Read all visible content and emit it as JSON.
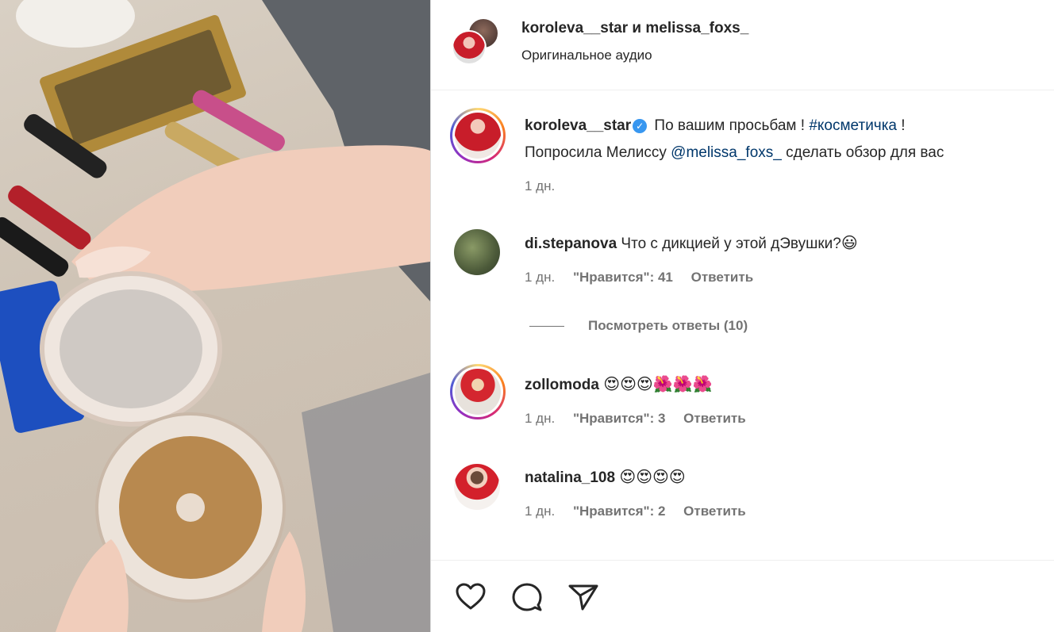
{
  "post": {
    "header_title": "koroleva__star и melissa_foxs_",
    "header_subtitle": "Оригинальное аудио"
  },
  "caption": {
    "username": "koroleva__star",
    "text_1": " По вашим просьбам ! ",
    "hashtag": "#косметичка",
    "text_2": " !",
    "line2_prefix": "Попросила Мелиссу ",
    "mention": "@melissa_foxs_",
    "line2_suffix": " сделать обзор для вас",
    "time": "1 дн."
  },
  "comments": [
    {
      "username": "di.stepanova",
      "text": " Что с дикцией у этой дЭвушки?",
      "emoji": "😃",
      "time": "1 дн.",
      "likes": "\"Нравится\": 41",
      "reply": "Ответить",
      "view_replies": "Посмотреть ответы (10)"
    },
    {
      "username": "zollomoda",
      "text": " ",
      "emoji": "😍😍😍🌺🌺🌺",
      "time": "1 дн.",
      "likes": "\"Нравится\": 3",
      "reply": "Ответить"
    },
    {
      "username": "natalina_108",
      "text": " ",
      "emoji": "😍😍😍😍",
      "time": "1 дн.",
      "likes": "\"Нравится\": 2",
      "reply": "Ответить"
    }
  ],
  "actions": {
    "like_icon": "heart-icon",
    "comment_icon": "comment-icon",
    "share_icon": "send-icon"
  },
  "colors": {
    "link": "#00376b",
    "verified": "#3897f0",
    "secondary_text": "#737373"
  }
}
